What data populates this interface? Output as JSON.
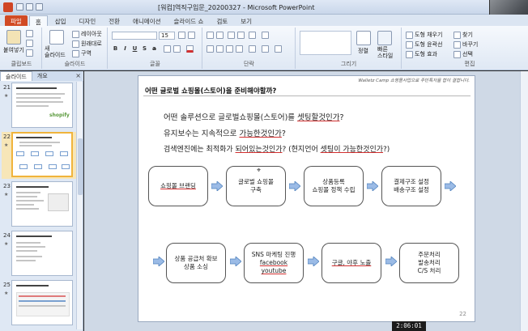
{
  "window": {
    "title": "[워컴]역직구입문_20200327 - Microsoft PowerPoint"
  },
  "ribbon_tabs": [
    "파일",
    "홈",
    "삽입",
    "디자인",
    "전환",
    "애니메이션",
    "슬라이드 쇼",
    "검토",
    "보기"
  ],
  "ribbon": {
    "paste_label": "붙여넣기",
    "new_slide_label": "새\n슬라이드",
    "layout_label": "레이아웃",
    "reset_label": "원래대로",
    "section_label": "구역",
    "font_size": "15",
    "find_label": "찾기",
    "replace_label": "바꾸기",
    "select_label": "선택",
    "shape_fill_label": "도형 채우기",
    "shape_outline_label": "도형 윤곽선",
    "shape_effect_label": "도형 효과",
    "arrange_label": "정렬",
    "quick_styles_label": "빠른\n스타일",
    "groups": {
      "clipboard": "클립보드",
      "slides": "슬라이드",
      "font": "글꼴",
      "paragraph": "단락",
      "drawing": "그리기",
      "editing": "편집"
    }
  },
  "panel": {
    "tabs": [
      "슬라이드",
      "개요"
    ],
    "close": "×",
    "slides": [
      {
        "num": "21"
      },
      {
        "num": "22"
      },
      {
        "num": "23"
      },
      {
        "num": "24"
      },
      {
        "num": "25"
      }
    ],
    "thumb_brand": "shopify"
  },
  "slide": {
    "title": "어떤 글로벌 쇼핑몰(스토어)을 준비해야할까?",
    "tag": "Walletz Camp 쇼핑몰사업으로 주민특처를 합이 결합니다.",
    "lines": [
      {
        "pre": "어떤 솔루션으로 글로벌쇼핑몰(스토어)를 ",
        "u": "셋팅할것인가",
        "post": "?"
      },
      {
        "pre": "유지보수는 지속적으로 ",
        "u": "가능한것인가",
        "post": "?"
      },
      {
        "pre": "검색엔진에는 최적화가 ",
        "u": "되어있는것인가",
        "post": "? (현지언어 ",
        "u2": "셋팅이 가능한것인가",
        "post2": "?)"
      }
    ],
    "row1": [
      {
        "l1": "쇼핑몰 브랜딩"
      },
      {
        "l1": "글로벌 쇼핑몰",
        "l2": "구축"
      },
      {
        "l1": "상품등록",
        "l2": "쇼핑몰 정책 수립"
      },
      {
        "l1": "결제구조 설정",
        "l2": "배송구조 설정"
      }
    ],
    "row2": [
      {
        "l1": "상품 공급처 확보",
        "l2": "상품 소싱"
      },
      {
        "l1": "SNS 마케팅 진행",
        "l2": "facebook",
        "l3": "youtube"
      },
      {
        "l1": "구글, 야후 노출"
      },
      {
        "l1": "주문처리",
        "l2": "발송처리",
        "l3": "C/S 처리"
      }
    ],
    "page_number": "22"
  },
  "timer": "2:06:01",
  "colors": {
    "accent": "#d14a24",
    "arrow_fill": "#9bbbe6",
    "arrow_stroke": "#4f81bd"
  }
}
